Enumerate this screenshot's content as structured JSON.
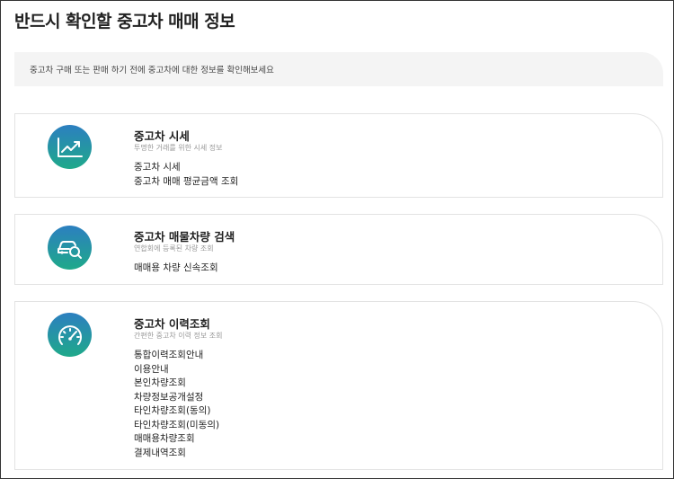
{
  "page": {
    "title": "반드시 확인할 중고차 매매 정보",
    "notice": "중고차 구매 또는 판매 하기 전에 중고차에 대한 정보를 확인해보세요"
  },
  "cards": [
    {
      "icon": "chart-trend-icon",
      "title": "중고차 시세",
      "subtitle": "투명한 거래를 위한 시세 정보",
      "links": [
        "중고차 시세",
        "중고차 매매 평균금액 조회"
      ]
    },
    {
      "icon": "car-search-icon",
      "title": "중고차 매물차량 검색",
      "subtitle": "연합회에 등록된 차량 조회",
      "links": [
        "매매용 차량 신속조회"
      ]
    },
    {
      "icon": "speedometer-icon",
      "title": "중고차 이력조회",
      "subtitle": "간편한 중고차 이력 정보 조회",
      "links": [
        "통합이력조회안내",
        "이용안내",
        "본인차량조회",
        "차량정보공개설정",
        "타인차량조회(동의)",
        "타인차량조회(미동의)",
        "매매용차량조회",
        "결제내역조회"
      ]
    }
  ],
  "colors": {
    "icon_gradient_top": "#2c7fc0",
    "icon_gradient_bottom": "#1fa98a"
  }
}
